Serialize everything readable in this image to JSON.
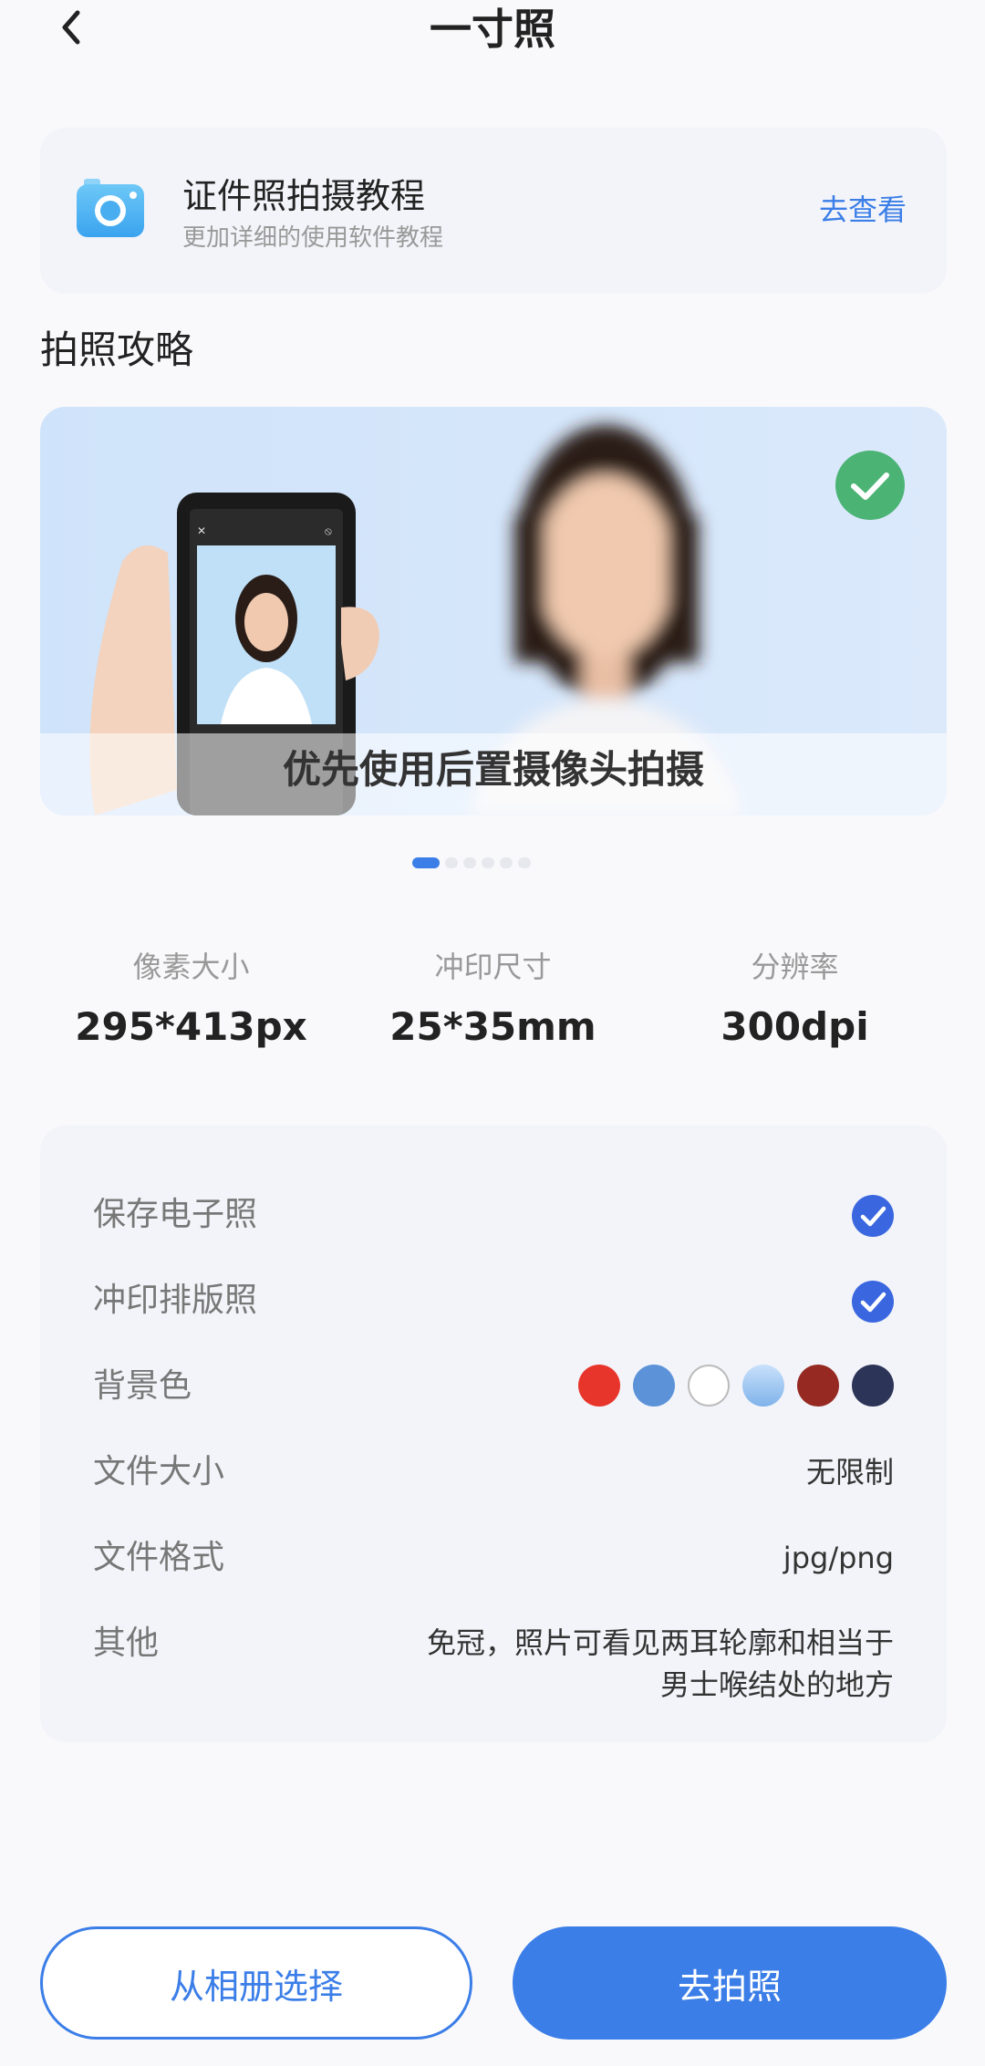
{
  "header": {
    "title": "一寸照",
    "back_icon": "chevron-left-icon"
  },
  "tutorial": {
    "icon": "camera-icon",
    "title": "证件照拍摄教程",
    "subtitle": "更加详细的使用软件教程",
    "link_label": "去查看"
  },
  "guide": {
    "section_title": "拍照攻略",
    "slide_caption": "优先使用后置摄像头拍摄",
    "badge_icon": "check-circle-icon",
    "slide_count": 6,
    "active_slide": 1
  },
  "specs": [
    {
      "label": "像素大小",
      "value": "295*413px"
    },
    {
      "label": "冲印尺寸",
      "value": "25*35mm"
    },
    {
      "label": "分辨率",
      "value": "300dpi"
    }
  ],
  "info": {
    "save_digital": {
      "label": "保存电子照",
      "checked": true
    },
    "print_layout": {
      "label": "冲印排版照",
      "checked": true
    },
    "background": {
      "label": "背景色",
      "colors": [
        "#e8352b",
        "#5c92d8",
        "#ffffff",
        "#a9cdf5",
        "#962a22",
        "#2c3558"
      ]
    },
    "file_size": {
      "label": "文件大小",
      "value": "无限制"
    },
    "file_format": {
      "label": "文件格式",
      "value": "jpg/png"
    },
    "other": {
      "label": "其他",
      "value_line1": "免冠，照片可看见两耳轮廓和相当于",
      "value_line2": "男士喉结处的地方"
    }
  },
  "actions": {
    "album_label": "从相册选择",
    "shoot_label": "去拍照"
  },
  "colors": {
    "accent": "#3b7ee8",
    "check_green": "#4bb475"
  }
}
